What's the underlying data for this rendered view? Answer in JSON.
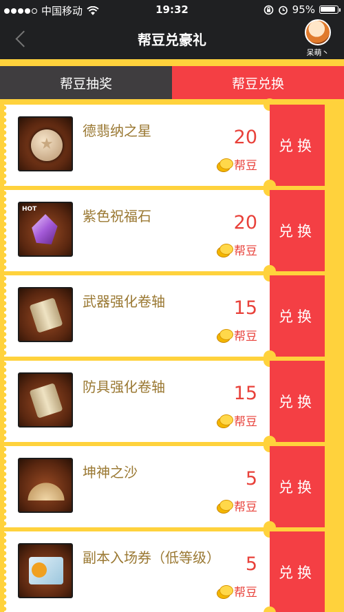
{
  "status_bar": {
    "carrier": "中国移动",
    "time": "19:32",
    "battery_percent": "95%",
    "battery_level": 0.95,
    "icons": [
      "signal-dots-icon",
      "wifi-icon",
      "rotation-lock-icon",
      "alarm-icon",
      "battery-icon"
    ]
  },
  "nav": {
    "title": "帮豆兑豪礼",
    "user_name": "呆萌丶"
  },
  "tabs": [
    {
      "label": "帮豆抽奖",
      "active": false
    },
    {
      "label": "帮豆兑换",
      "active": true
    }
  ],
  "accent_color": "#f43f44",
  "background_color": "#ffd23c",
  "items": [
    {
      "name": "德翡纳之星",
      "price": "20",
      "unit": "帮豆",
      "button": "兑换",
      "icon": "medal-icon"
    },
    {
      "name": "紫色祝福石",
      "price": "20",
      "unit": "帮豆",
      "button": "兑换",
      "icon": "crystal-icon",
      "badge": "HOT"
    },
    {
      "name": "武器强化卷轴",
      "price": "15",
      "unit": "帮豆",
      "button": "兑换",
      "icon": "scroll-icon"
    },
    {
      "name": "防具强化卷轴",
      "price": "15",
      "unit": "帮豆",
      "button": "兑换",
      "icon": "scroll-icon"
    },
    {
      "name": "坤神之沙",
      "price": "5",
      "unit": "帮豆",
      "button": "兑换",
      "icon": "sand-icon"
    },
    {
      "name": "副本入场券（低等级）",
      "price": "5",
      "unit": "帮豆",
      "button": "兑换",
      "icon": "ticket-icon"
    }
  ]
}
